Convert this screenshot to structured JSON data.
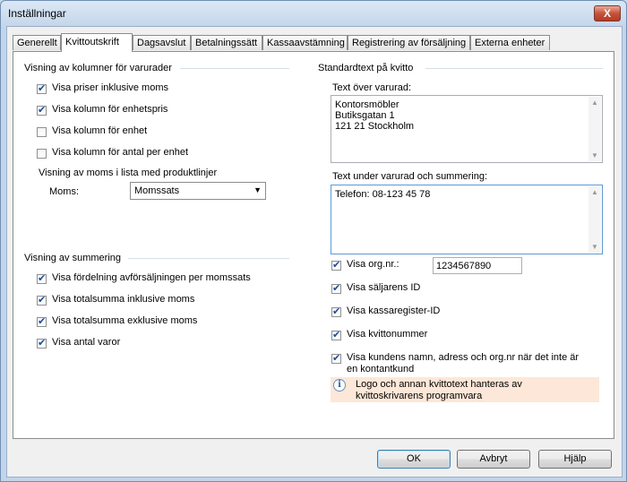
{
  "window": {
    "title": "Inställningar",
    "close_glyph": "X"
  },
  "tabs": [
    {
      "label": "Generellt"
    },
    {
      "label": "Kvittoutskrift",
      "active": true
    },
    {
      "label": "Dagsavslut"
    },
    {
      "label": "Betalningssätt"
    },
    {
      "label": "Kassaavstämning"
    },
    {
      "label": "Registrering av försäljning"
    },
    {
      "label": "Externa enheter"
    }
  ],
  "columns_group": {
    "title": "Visning av kolumner för varurader",
    "checkboxes": [
      {
        "label": "Visa priser inklusive moms",
        "checked": true
      },
      {
        "label": "Visa kolumn för enhetspris",
        "checked": true
      },
      {
        "label": "Visa kolumn för enhet",
        "checked": false
      },
      {
        "label": "Visa kolumn för antal per enhet",
        "checked": false
      }
    ],
    "vat_caption": "Visning av moms i lista med produktlinjer",
    "vat_label": "Moms:",
    "vat_value": "Momssats"
  },
  "summary_group": {
    "title": "Visning av summering",
    "checkboxes": [
      {
        "label": "Visa fördelning avförsäljningen per momssats",
        "checked": true
      },
      {
        "label": "Visa totalsumma inklusive moms",
        "checked": true
      },
      {
        "label": "Visa totalsumma exklusive moms",
        "checked": true
      },
      {
        "label": "Visa antal varor",
        "checked": true
      }
    ]
  },
  "standard_text": {
    "title": "Standardtext på kvitto",
    "above_label": "Text över varurad:",
    "above_lines": "Kontorsmöbler\nButiksgatan 1\n121 21 Stockholm",
    "below_label": "Text under varurad och summering:",
    "below_lines": "Telefon: 08-123 45 78",
    "org_label": "Visa org.nr.:",
    "org_checked": true,
    "org_value": "1234567890",
    "checkboxes": [
      {
        "label": "Visa säljarens ID",
        "checked": true
      },
      {
        "label": "Visa kassaregister-ID",
        "checked": true
      },
      {
        "label": "Visa kvittonummer",
        "checked": true
      },
      {
        "label": "Visa kundens namn, adress och org.nr när det inte är\nen kontantkund",
        "checked": true
      }
    ],
    "info_icon": "info-icon",
    "info_text": "Logo och annan kvittotext hanteras av\nkvittoskrivarens programvara"
  },
  "buttons": {
    "ok": "OK",
    "cancel": "Avbryt",
    "help": "Hjälp"
  }
}
